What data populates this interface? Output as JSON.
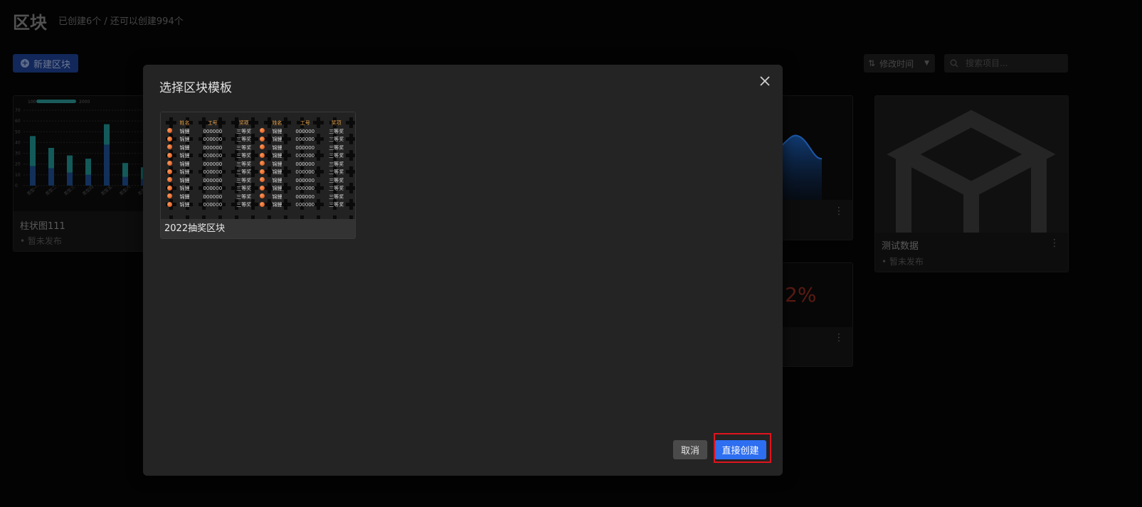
{
  "header": {
    "title": "区块",
    "subtitle": "已创建6个 / 还可以创建994个"
  },
  "toolbar": {
    "new_label": "新建区块",
    "sort_label": "修改时间",
    "search_placeholder": "搜索项目..."
  },
  "cards": [
    {
      "name": "柱状图111",
      "status": "• 暂未发布"
    },
    {
      "name": "测试数据",
      "status": "• 暂未发布"
    },
    {
      "value_text": "2%"
    }
  ],
  "bar_chart": {
    "legend_min": "100",
    "legend_max": "2000",
    "yticks": [
      "70",
      "60",
      "50",
      "40",
      "30",
      "20",
      "10",
      "0"
    ],
    "categories": [
      "类型一",
      "类型二",
      "类型三",
      "类型四",
      "类型五",
      "类型六",
      "类型七"
    ],
    "dark_values": [
      18,
      16,
      12,
      10,
      38,
      8,
      6
    ],
    "light_values": [
      28,
      19,
      16,
      15,
      19,
      13,
      11
    ],
    "ylim": [
      0,
      70
    ]
  },
  "modal": {
    "title": "选择区块模板",
    "template": {
      "name": "2022抽奖区块",
      "headers": [
        "姓名",
        "工号",
        "奖项",
        "姓名",
        "工号",
        "奖项"
      ],
      "row": [
        "锦鲤",
        "000000",
        "三等奖",
        "锦鲤",
        "000000",
        "三等奖"
      ]
    },
    "cancel_label": "取消",
    "create_label": "直接创建"
  }
}
